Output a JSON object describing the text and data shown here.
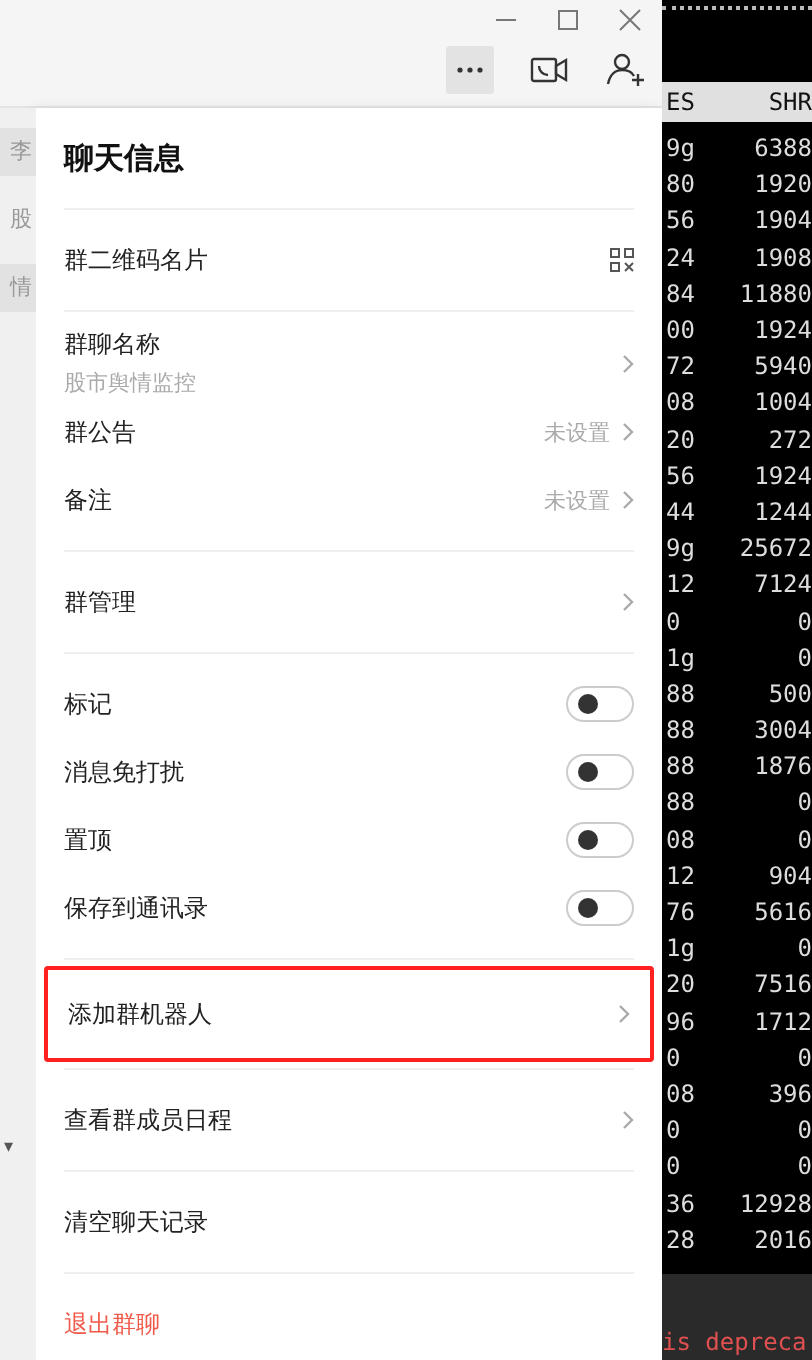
{
  "sidebar": {
    "items": [
      {
        "label": "李",
        "selected": true
      },
      {
        "label": "股",
        "selected": false
      },
      {
        "label": "情",
        "selected": true
      }
    ],
    "dropdown_mark": "▾"
  },
  "panel": {
    "title": "聊天信息",
    "groups": [
      [
        {
          "kind": "qr",
          "label": "群二维码名片"
        }
      ],
      [
        {
          "kind": "link",
          "label": "群聊名称",
          "subtitle": "股市舆情监控"
        },
        {
          "kind": "link",
          "label": "群公告",
          "value": "未设置"
        },
        {
          "kind": "link",
          "label": "备注",
          "value": "未设置"
        }
      ],
      [
        {
          "kind": "link",
          "label": "群管理"
        }
      ],
      [
        {
          "kind": "toggle",
          "label": "标记",
          "on": false
        },
        {
          "kind": "toggle",
          "label": "消息免打扰",
          "on": false
        },
        {
          "kind": "toggle",
          "label": "置顶",
          "on": false
        },
        {
          "kind": "toggle",
          "label": "保存到通讯录",
          "on": false
        }
      ],
      [
        {
          "kind": "link",
          "label": "添加群机器人",
          "highlighted": true
        }
      ],
      [
        {
          "kind": "link",
          "label": "查看群成员日程",
          "highlighted": false
        }
      ],
      [
        {
          "kind": "plain",
          "label": "清空聊天记录"
        }
      ],
      [
        {
          "kind": "danger",
          "label": "退出群聊"
        }
      ]
    ]
  },
  "terminal": {
    "columns": [
      "ES",
      "SHR"
    ],
    "rows": [
      [
        "9g",
        "6388"
      ],
      [
        "80",
        "1920"
      ],
      [
        "56",
        "1904"
      ],
      [
        "24",
        "1908"
      ],
      [
        "84",
        "11880"
      ],
      [
        "00",
        "1924"
      ],
      [
        "72",
        "5940"
      ],
      [
        "08",
        "1004"
      ],
      [
        "20",
        "272"
      ],
      [
        "56",
        "1924"
      ],
      [
        "44",
        "1244"
      ],
      [
        "9g",
        "25672"
      ],
      [
        "12",
        "7124"
      ],
      [
        "0",
        "0"
      ],
      [
        "1g",
        "0"
      ],
      [
        "88",
        "500"
      ],
      [
        "88",
        "3004"
      ],
      [
        "88",
        "1876"
      ],
      [
        "88",
        "0"
      ],
      [
        "08",
        "0"
      ],
      [
        "12",
        "904"
      ],
      [
        "76",
        "5616"
      ],
      [
        "1g",
        "0"
      ],
      [
        "20",
        "7516"
      ],
      [
        "96",
        "1712"
      ],
      [
        "0",
        "0"
      ],
      [
        "08",
        "396"
      ],
      [
        "0",
        "0"
      ],
      [
        "0",
        "0"
      ],
      [
        "36",
        "12928"
      ],
      [
        "28",
        "2016"
      ]
    ],
    "message": "is depreca"
  }
}
